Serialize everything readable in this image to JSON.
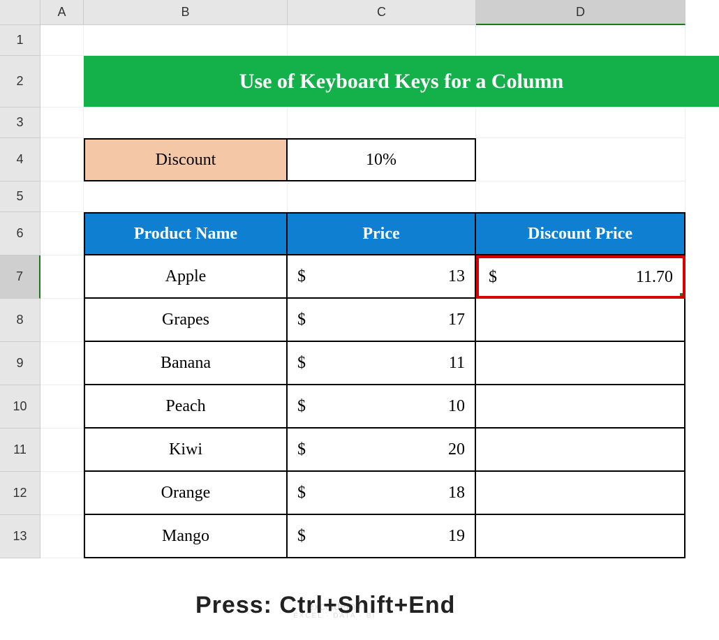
{
  "columns": [
    "A",
    "B",
    "C",
    "D"
  ],
  "rows": [
    "1",
    "2",
    "3",
    "4",
    "5",
    "6",
    "7",
    "8",
    "9",
    "10",
    "11",
    "12",
    "13"
  ],
  "selected_column": "D",
  "selected_row": "7",
  "title": "Use of Keyboard Keys for a Column",
  "discount": {
    "label": "Discount",
    "value": "10%"
  },
  "table": {
    "headers": [
      "Product Name",
      "Price",
      "Discount Price"
    ],
    "currency": "$",
    "rows": [
      {
        "name": "Apple",
        "price": "13",
        "discount_price": "11.70"
      },
      {
        "name": "Grapes",
        "price": "17",
        "discount_price": ""
      },
      {
        "name": "Banana",
        "price": "11",
        "discount_price": ""
      },
      {
        "name": "Peach",
        "price": "10",
        "discount_price": ""
      },
      {
        "name": "Kiwi",
        "price": "20",
        "discount_price": ""
      },
      {
        "name": "Orange",
        "price": "18",
        "discount_price": ""
      },
      {
        "name": "Mango",
        "price": "19",
        "discount_price": ""
      }
    ]
  },
  "instruction": "Press: Ctrl+Shift+End",
  "watermark": {
    "line1": "exceldemy",
    "line2": "EXCEL · DATA · BI"
  }
}
